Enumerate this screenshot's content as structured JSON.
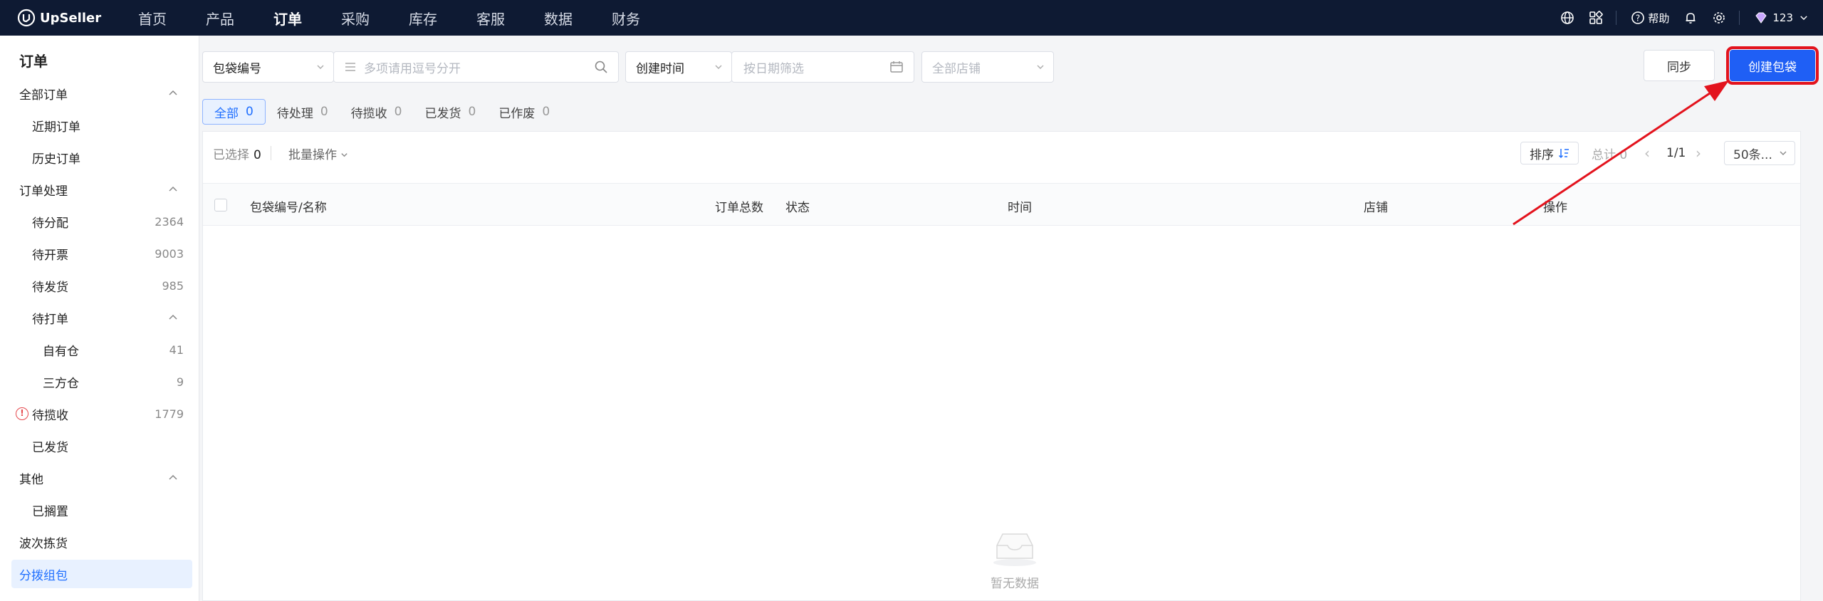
{
  "brand": {
    "name": "UpSeller"
  },
  "nav": {
    "items": [
      "首页",
      "产品",
      "订单",
      "采购",
      "库存",
      "客服",
      "数据",
      "财务"
    ],
    "active": "订单"
  },
  "topright": {
    "help": "帮助",
    "user": "123"
  },
  "sidebar": {
    "title": "订单",
    "sections": {
      "all_orders": "全部订单",
      "recent": "近期订单",
      "history": "历史订单",
      "processing": "订单处理",
      "to_assign": "待分配",
      "to_assign_count": "2364",
      "to_invoice": "待开票",
      "to_invoice_count": "9003",
      "to_ship": "待发货",
      "to_ship_count": "985",
      "to_print": "待打单",
      "own_wh": "自有仓",
      "own_wh_count": "41",
      "third_wh": "三方仓",
      "third_wh_count": "9",
      "to_pickup": "待揽收",
      "to_pickup_count": "1779",
      "shipped": "已发货",
      "others": "其他",
      "shelved": "已搁置",
      "wave_pick": "波次拣货",
      "sort_pack": "分拨组包"
    }
  },
  "filters": {
    "search_type": "包袋编号",
    "search_placeholder": "多项请用逗号分开",
    "time_type": "创建时间",
    "date_placeholder": "按日期筛选",
    "store_placeholder": "全部店铺"
  },
  "buttons": {
    "sync": "同步",
    "create": "创建包袋"
  },
  "tabs": [
    {
      "label": "全部",
      "count": "0"
    },
    {
      "label": "待处理",
      "count": "0"
    },
    {
      "label": "待揽收",
      "count": "0"
    },
    {
      "label": "已发货",
      "count": "0"
    },
    {
      "label": "已作废",
      "count": "0"
    }
  ],
  "toolbar": {
    "selected_label": "已选择",
    "selected_count": "0",
    "batch": "批量操作",
    "sort": "排序",
    "total": "总计 0",
    "page": "1/1",
    "page_size": "50条..."
  },
  "table": {
    "headers": [
      "包袋编号/名称",
      "订单总数",
      "状态",
      "时间",
      "店铺",
      "操作"
    ]
  },
  "empty_text": "暂无数据",
  "colors": {
    "topbar": "#0e1a33",
    "primary": "#1f5ff5",
    "highlight": "#e3131d"
  }
}
